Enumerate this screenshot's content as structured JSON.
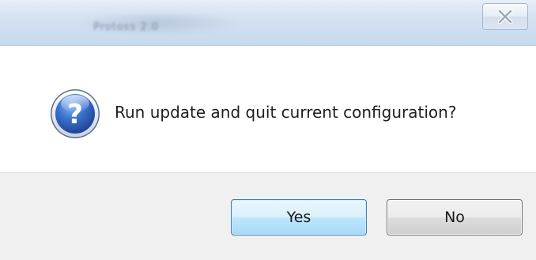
{
  "window": {
    "title": "Protoss 2.0",
    "close_icon": "close-icon"
  },
  "message": {
    "icon": "question-icon",
    "icon_glyph": "?",
    "text": "Run update and quit current configuration?"
  },
  "buttons": {
    "yes_label": "Yes",
    "no_label": "No"
  },
  "colors": {
    "icon_blue": "#2f5fb6",
    "default_button_border": "#3c7fb1",
    "button_bar_bg": "#f0f0f0"
  }
}
